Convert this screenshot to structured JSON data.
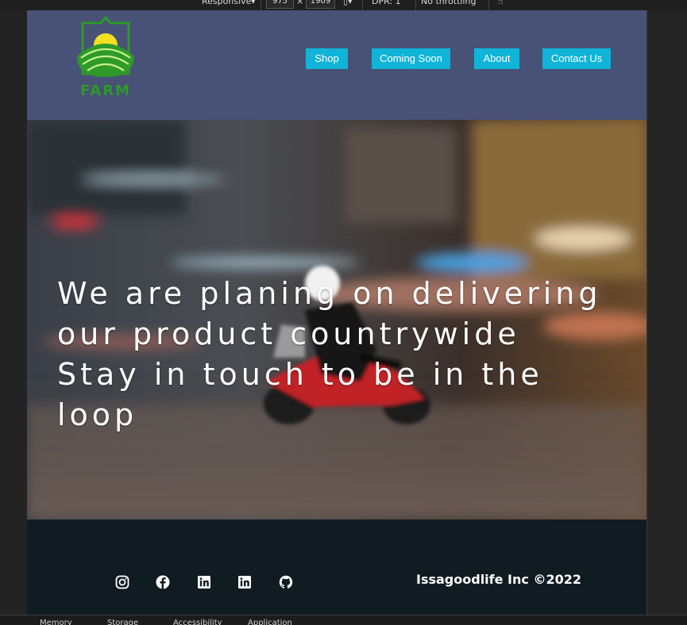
{
  "devtools": {
    "device": "Responsive",
    "width": "975",
    "height": "1909",
    "dpr": "DPR: 1",
    "throttling": "No throttling",
    "bottom_tabs": [
      "Memory",
      "Storage",
      "Accessibility",
      "Application"
    ]
  },
  "header": {
    "logo_text": "FARM",
    "nav": [
      "Shop",
      "Coming Soon",
      "About",
      "Contact Us"
    ]
  },
  "hero": {
    "line1": "We are planing on delivering",
    "line2": "our product countrywide",
    "line3": "Stay in touch to be in the",
    "line4": "loop"
  },
  "footer": {
    "social_icons": [
      "instagram-icon",
      "facebook-icon",
      "linkedin-icon",
      "linkedin-icon",
      "github-icon"
    ],
    "copyright": "Issagoodlife Inc ©2022"
  },
  "colors": {
    "header_bg": "#485176",
    "nav_button": "#10b4d8",
    "footer_bg": "#111b22",
    "logo_green": "#2e9a2a",
    "logo_sun": "#f2e021"
  }
}
